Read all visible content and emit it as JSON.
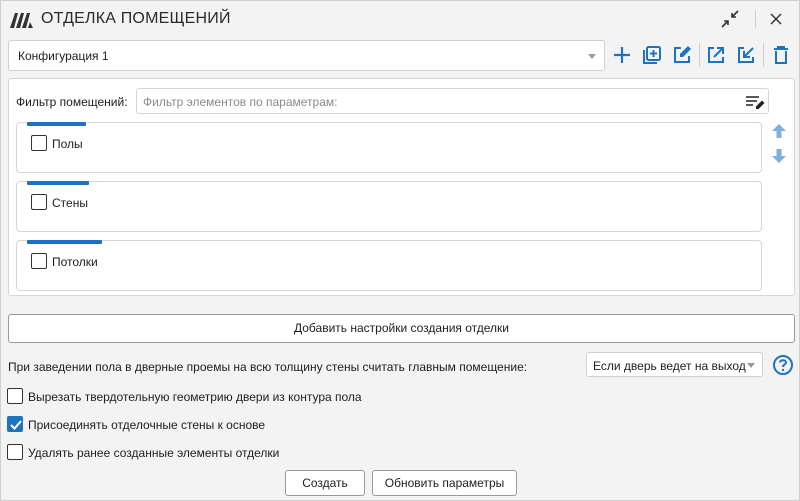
{
  "window": {
    "title": "ОТДЕЛКА ПОМЕЩЕНИЙ"
  },
  "config": {
    "selected": "Конфигурация 1"
  },
  "filter": {
    "label": "Фильтр помещений:",
    "placeholder": "Фильтр элементов по параметрам:"
  },
  "groups": [
    {
      "label": "Полы",
      "checked": false
    },
    {
      "label": "Стены",
      "checked": false
    },
    {
      "label": "Потолки",
      "checked": false
    }
  ],
  "add_settings_button": "Добавить настройки создания отделки",
  "door": {
    "label": "При заведении пола в дверные проемы на всю толщину стены считать главным помещение:",
    "selected": "Если дверь ведет на выход"
  },
  "options": [
    {
      "label": "Вырезать твердотельную геометрию двери из контура пола",
      "checked": false
    },
    {
      "label": "Присоединять отделочные стены к основе",
      "checked": true
    },
    {
      "label": "Удалять ранее созданные элементы отделки",
      "checked": false
    }
  ],
  "buttons": {
    "create": "Создать",
    "update": "Обновить параметры"
  },
  "icons": {
    "logo": "logo-icon",
    "collapse": "collapse-icon",
    "close": "close-icon",
    "add": "plus-icon",
    "duplicate": "duplicate-icon",
    "edit": "edit-icon",
    "export": "export-icon",
    "import": "import-icon",
    "delete": "trash-icon",
    "filter_edit": "filter-edit-icon",
    "move_up": "arrow-up-icon",
    "move_down": "arrow-down-icon",
    "help": "help-icon"
  },
  "colors": {
    "accent": "#1e73be",
    "accent_light": "#7fb0dc"
  }
}
